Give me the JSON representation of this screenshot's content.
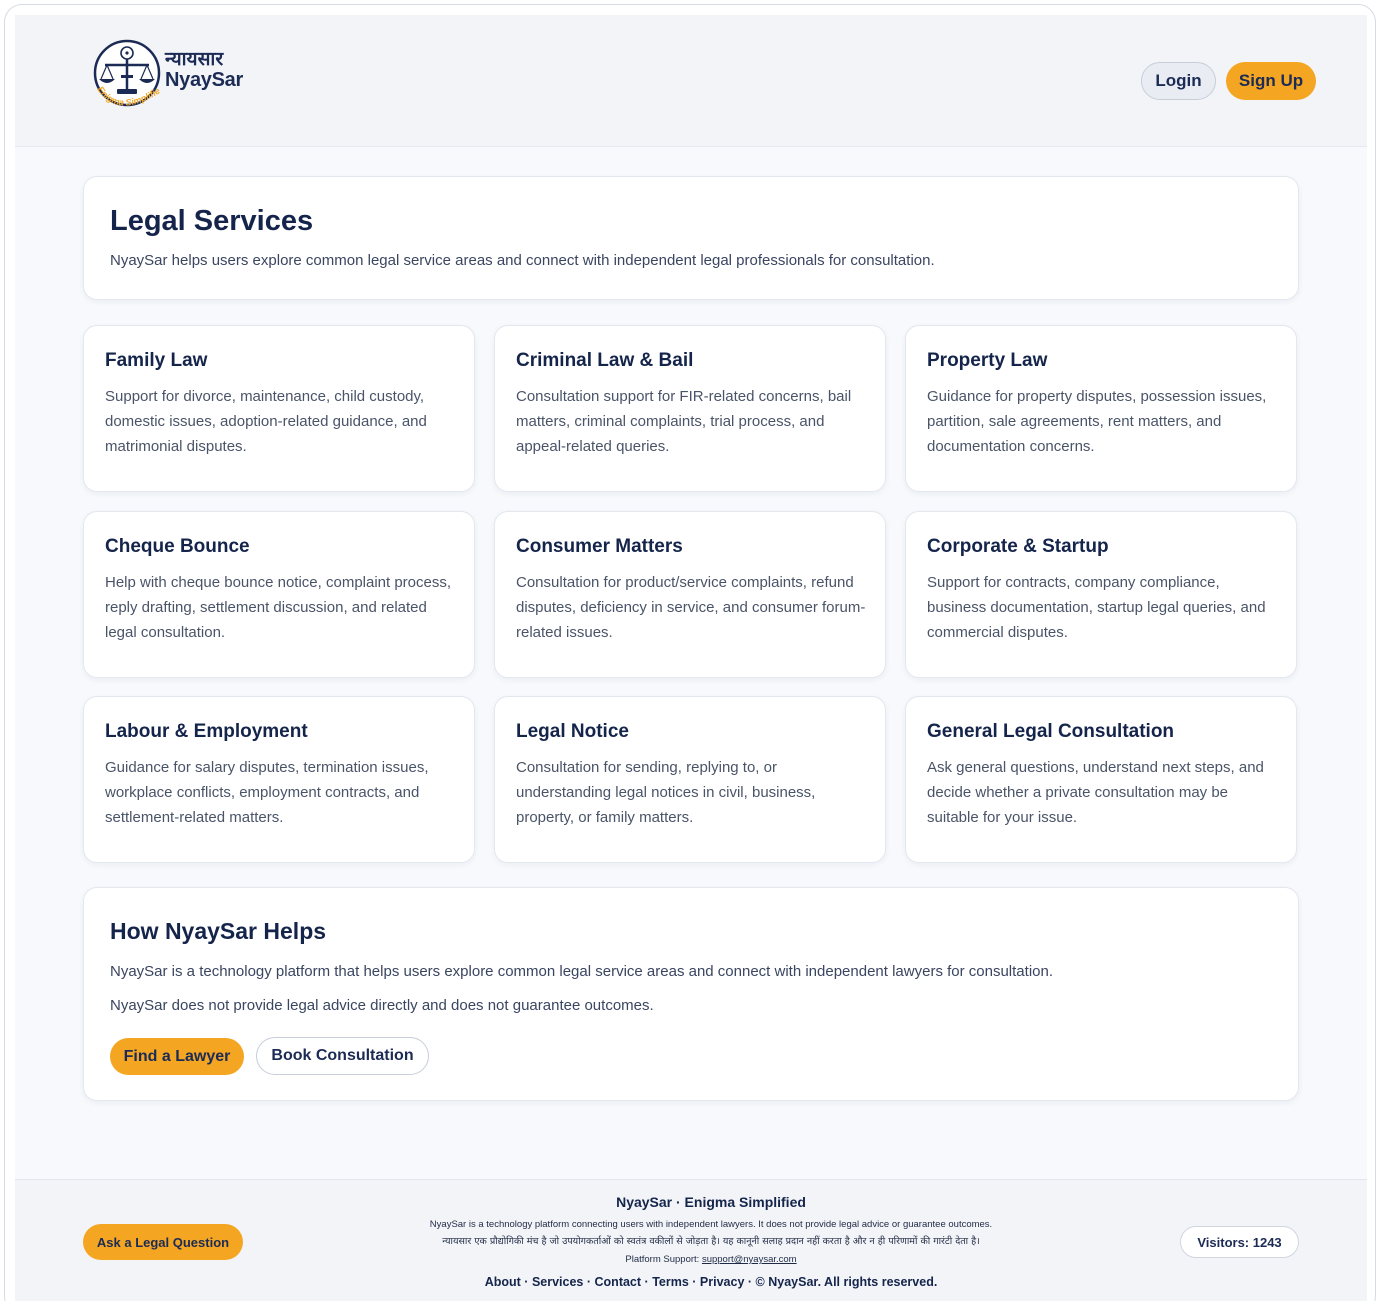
{
  "brand": {
    "name_hindi": "न्यायसार",
    "name": "NyaySar",
    "tagline": "Enigma Simplified"
  },
  "header": {
    "login_label": "Login",
    "signup_label": "Sign Up"
  },
  "intro": {
    "title": "Legal Services",
    "description": "NyaySar helps users explore common legal service areas and connect with independent legal professionals for consultation."
  },
  "services": [
    {
      "title": "Family Law",
      "description": "Support for divorce, maintenance, child custody, domestic issues, adoption-related guidance, and matrimonial disputes."
    },
    {
      "title": "Criminal Law & Bail",
      "description": "Consultation support for FIR-related concerns, bail matters, criminal complaints, trial process, and appeal-related queries."
    },
    {
      "title": "Property Law",
      "description": "Guidance for property disputes, possession issues, partition, sale agreements, rent matters, and documentation concerns."
    },
    {
      "title": "Cheque Bounce",
      "description": "Help with cheque bounce notice, complaint process, reply drafting, settlement discussion, and related legal consultation."
    },
    {
      "title": "Consumer Matters",
      "description": "Consultation for product/service complaints, refund disputes, deficiency in service, and consumer forum-related issues."
    },
    {
      "title": "Corporate & Startup",
      "description": "Support for contracts, company compliance, business documentation, startup legal queries, and commercial disputes."
    },
    {
      "title": "Labour & Employment",
      "description": "Guidance for salary disputes, termination issues, workplace conflicts, employment contracts, and settlement-related matters."
    },
    {
      "title": "Legal Notice",
      "description": "Consultation for sending, replying to, or understanding legal notices in civil, business, property, or family matters."
    },
    {
      "title": "General Legal Consultation",
      "description": "Ask general questions, understand next steps, and decide whether a private consultation may be suitable for your issue."
    }
  ],
  "helps": {
    "title": "How NyaySar Helps",
    "paragraph1": "NyaySar is a technology platform that helps users explore common legal service areas and connect with independent lawyers for consultation.",
    "paragraph2": "NyaySar does not provide legal advice directly and does not guarantee outcomes.",
    "find_lawyer_label": "Find a Lawyer",
    "book_consultation_label": "Book Consultation"
  },
  "footer": {
    "ask_question_label": "Ask a Legal Question",
    "title": "NyaySar · Enigma Simplified",
    "disclaimer_en": "NyaySar is a technology platform connecting users with independent lawyers. It does not provide legal advice or guarantee outcomes.",
    "disclaimer_hi": "न्यायसार एक प्रौद्योगिकी मंच है जो उपयोगकर्ताओं को स्वतंत्र वकीलों से जोड़ता है। यह कानूनी सलाह प्रदान नहीं करता है और न ही परिणामों की गारंटी देता है।",
    "support_prefix": "Platform Support:",
    "support_email": "support@nyaysar.com",
    "links": [
      "About",
      "Services",
      "Contact",
      "Terms",
      "Privacy"
    ],
    "separator": "·",
    "copyright": "© NyaySar. All rights reserved.",
    "visitors_label": "Visitors: 1243"
  },
  "colors": {
    "accent": "#f4a623",
    "navy": "#14244a",
    "background": "#f2f4f8"
  }
}
